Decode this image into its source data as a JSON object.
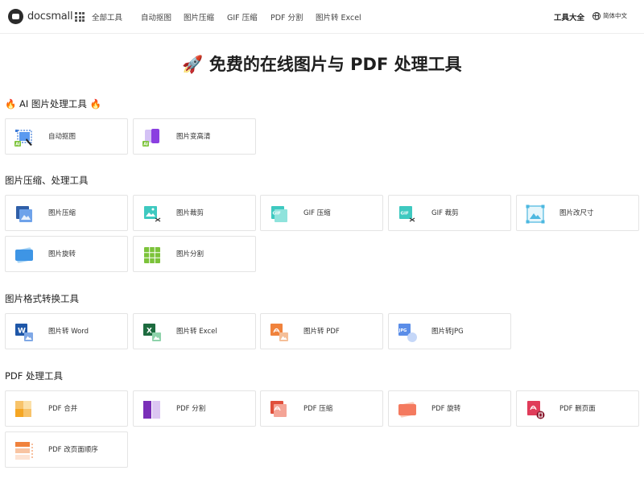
{
  "header": {
    "logo_text": "docsmall",
    "all_tools": "全部工具",
    "nav": [
      "自动抠图",
      "图片压缩",
      "GIF 压缩",
      "PDF 分割",
      "图片转 Excel"
    ],
    "tools_catalog": "工具大全",
    "language": "简体中文"
  },
  "page_title": "🚀 免费的在线图片与 PDF 处理工具",
  "sections": [
    {
      "title": "🔥 AI 图片处理工具 🔥",
      "tools": [
        {
          "label": "自动抠图",
          "icon": "ai-cutout-icon"
        },
        {
          "label": "图片变高清",
          "icon": "ai-enhance-icon"
        }
      ]
    },
    {
      "title": "图片压缩、处理工具",
      "tools": [
        {
          "label": "图片压缩",
          "icon": "image-compress-icon"
        },
        {
          "label": "图片裁剪",
          "icon": "image-crop-icon"
        },
        {
          "label": "GIF 压缩",
          "icon": "gif-compress-icon",
          "icon_text": "GIF"
        },
        {
          "label": "GIF 裁剪",
          "icon": "gif-crop-icon",
          "icon_text": "GIF"
        },
        {
          "label": "图片改尺寸",
          "icon": "image-resize-icon"
        },
        {
          "label": "图片旋转",
          "icon": "image-rotate-icon"
        },
        {
          "label": "图片分割",
          "icon": "image-split-icon"
        }
      ]
    },
    {
      "title": "图片格式转换工具",
      "tools": [
        {
          "label": "图片转 Word",
          "icon": "word-icon",
          "icon_text": "W"
        },
        {
          "label": "图片转 Excel",
          "icon": "excel-icon",
          "icon_text": "X"
        },
        {
          "label": "图片转 PDF",
          "icon": "pdf-icon"
        },
        {
          "label": "图片转JPG",
          "icon": "jpg-icon",
          "icon_text": "JPG"
        }
      ]
    },
    {
      "title": "PDF 处理工具",
      "tools": [
        {
          "label": "PDF 合并",
          "icon": "pdf-merge-icon"
        },
        {
          "label": "PDF 分割",
          "icon": "pdf-split-icon"
        },
        {
          "label": "PDF 压缩",
          "icon": "pdf-compress-icon"
        },
        {
          "label": "PDF 旋转",
          "icon": "pdf-rotate-icon"
        },
        {
          "label": "PDF 删页面",
          "icon": "pdf-delete-page-icon"
        },
        {
          "label": "PDF 改页面顺序",
          "icon": "pdf-reorder-icon"
        }
      ]
    }
  ],
  "colors": {
    "text": "#222222",
    "card_border": "#e4e4e4",
    "image_blue": "#3d7bd8",
    "teal": "#3ec9c0",
    "green": "#7cc33a",
    "word_blue": "#1f57a8",
    "excel_green": "#1d6b3f",
    "pdf_orange": "#f0823c",
    "pdf_red": "#e0503c",
    "purple": "#8a3fe0"
  }
}
